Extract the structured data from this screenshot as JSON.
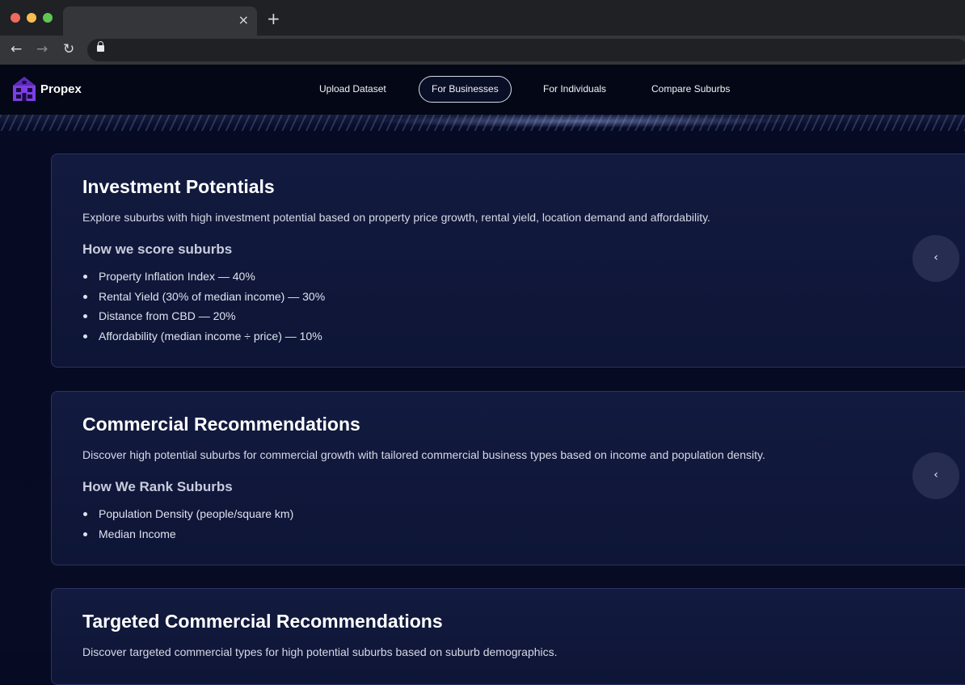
{
  "browser": {
    "tab_title": "",
    "close_tab_glyph": "×",
    "new_tab_glyph": "+",
    "back_glyph": "←",
    "forward_glyph": "→",
    "reload_glyph": "↻",
    "url": ""
  },
  "header": {
    "brand": "Propex",
    "logo_color": "#7b3fe4",
    "nav": [
      {
        "label": "Upload Dataset",
        "active": false
      },
      {
        "label": "For Businesses",
        "active": true
      },
      {
        "label": "For Individuals",
        "active": false
      },
      {
        "label": "Compare Suburbs",
        "active": false
      }
    ]
  },
  "cards": [
    {
      "title": "Investment Potentials",
      "description": "Explore suburbs with high investment potential based on property price growth, rental yield, location demand and affordability.",
      "subtitle": "How we score suburbs",
      "items": [
        "Property Inflation Index — 40%",
        "Rental Yield (30% of median income) — 30%",
        "Distance from CBD — 20%",
        "Affordability (median income ÷ price) — 10%"
      ],
      "button_glyph": "‹"
    },
    {
      "title": "Commercial Recommendations",
      "description": "Discover high potential suburbs for commercial growth with tailored commercial business types based on income and population density.",
      "subtitle": "How We Rank Suburbs",
      "items": [
        "Population Density (people/square km)",
        "Median Income"
      ],
      "button_glyph": "‹"
    },
    {
      "title": "Targeted Commercial Recommendations",
      "description": "Discover targeted commercial types for high potential suburbs based on suburb demographics."
    }
  ]
}
